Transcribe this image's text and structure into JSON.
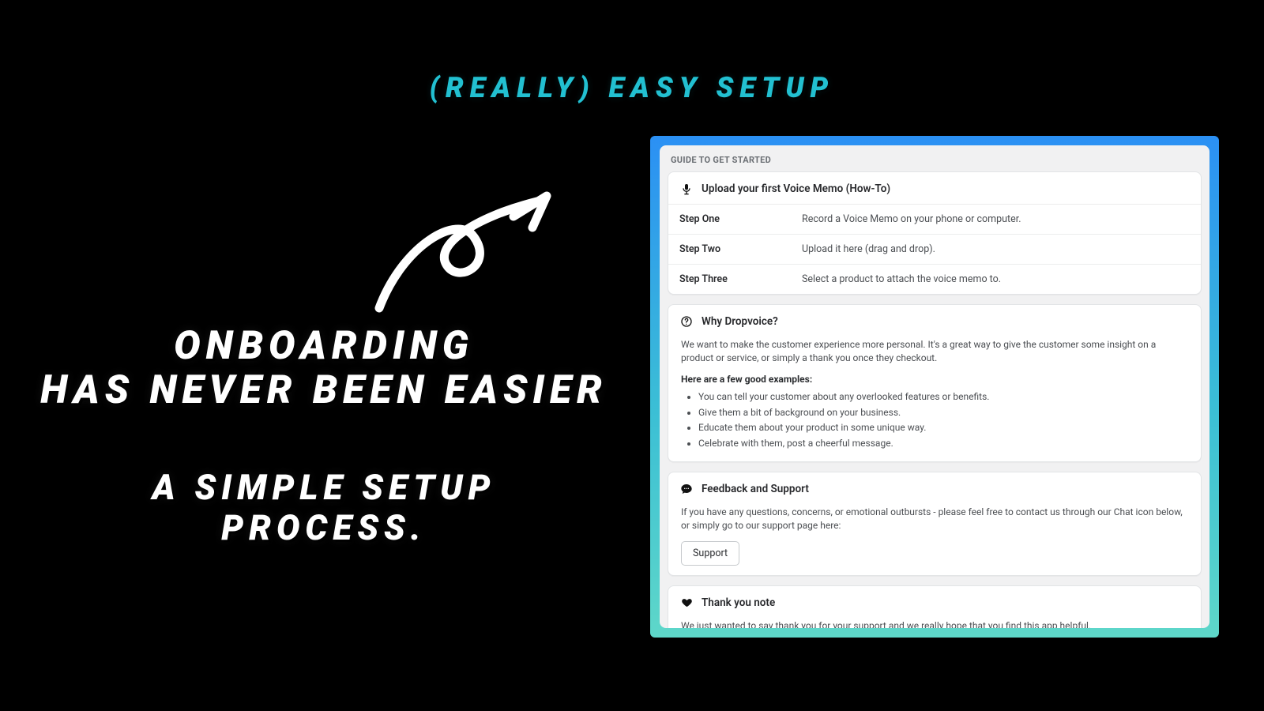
{
  "headline": "(REALLY) EASY SETUP",
  "left": {
    "line1": "ONBOARDING",
    "line2": "HAS NEVER BEEN EASIER",
    "line3": "A SIMPLE SETUP",
    "line4": "PROCESS."
  },
  "panel": {
    "guide_label": "GUIDE TO GET STARTED",
    "upload": {
      "title": "Upload your first Voice Memo (How-To)",
      "steps": [
        {
          "label": "Step One",
          "text": "Record a Voice Memo on your phone or computer."
        },
        {
          "label": "Step Two",
          "text": "Upload it here (drag and drop)."
        },
        {
          "label": "Step Three",
          "text": "Select a product to attach the voice memo to."
        }
      ]
    },
    "why": {
      "title": "Why Dropvoice?",
      "paragraph": "We want to make the customer experience more personal. It's a great way to give the customer some insight on a product or service, or simply a thank you once they checkout.",
      "examples_label": "Here are a few good examples:",
      "examples": [
        "You can tell your customer about any overlooked features or benefits.",
        "Give them a bit of background on your business.",
        "Educate them about your product in some unique way.",
        "Celebrate with them, post a cheerful message."
      ]
    },
    "feedback": {
      "title": "Feedback and Support",
      "paragraph": "If you have any questions, concerns, or emotional outbursts - please feel free to contact us through our Chat icon below, or simply go to our support page here:",
      "button": "Support"
    },
    "thankyou": {
      "title": "Thank you note",
      "paragraph": "We just wanted to say thank you for your support and we really hope that you find this app helpful."
    }
  }
}
